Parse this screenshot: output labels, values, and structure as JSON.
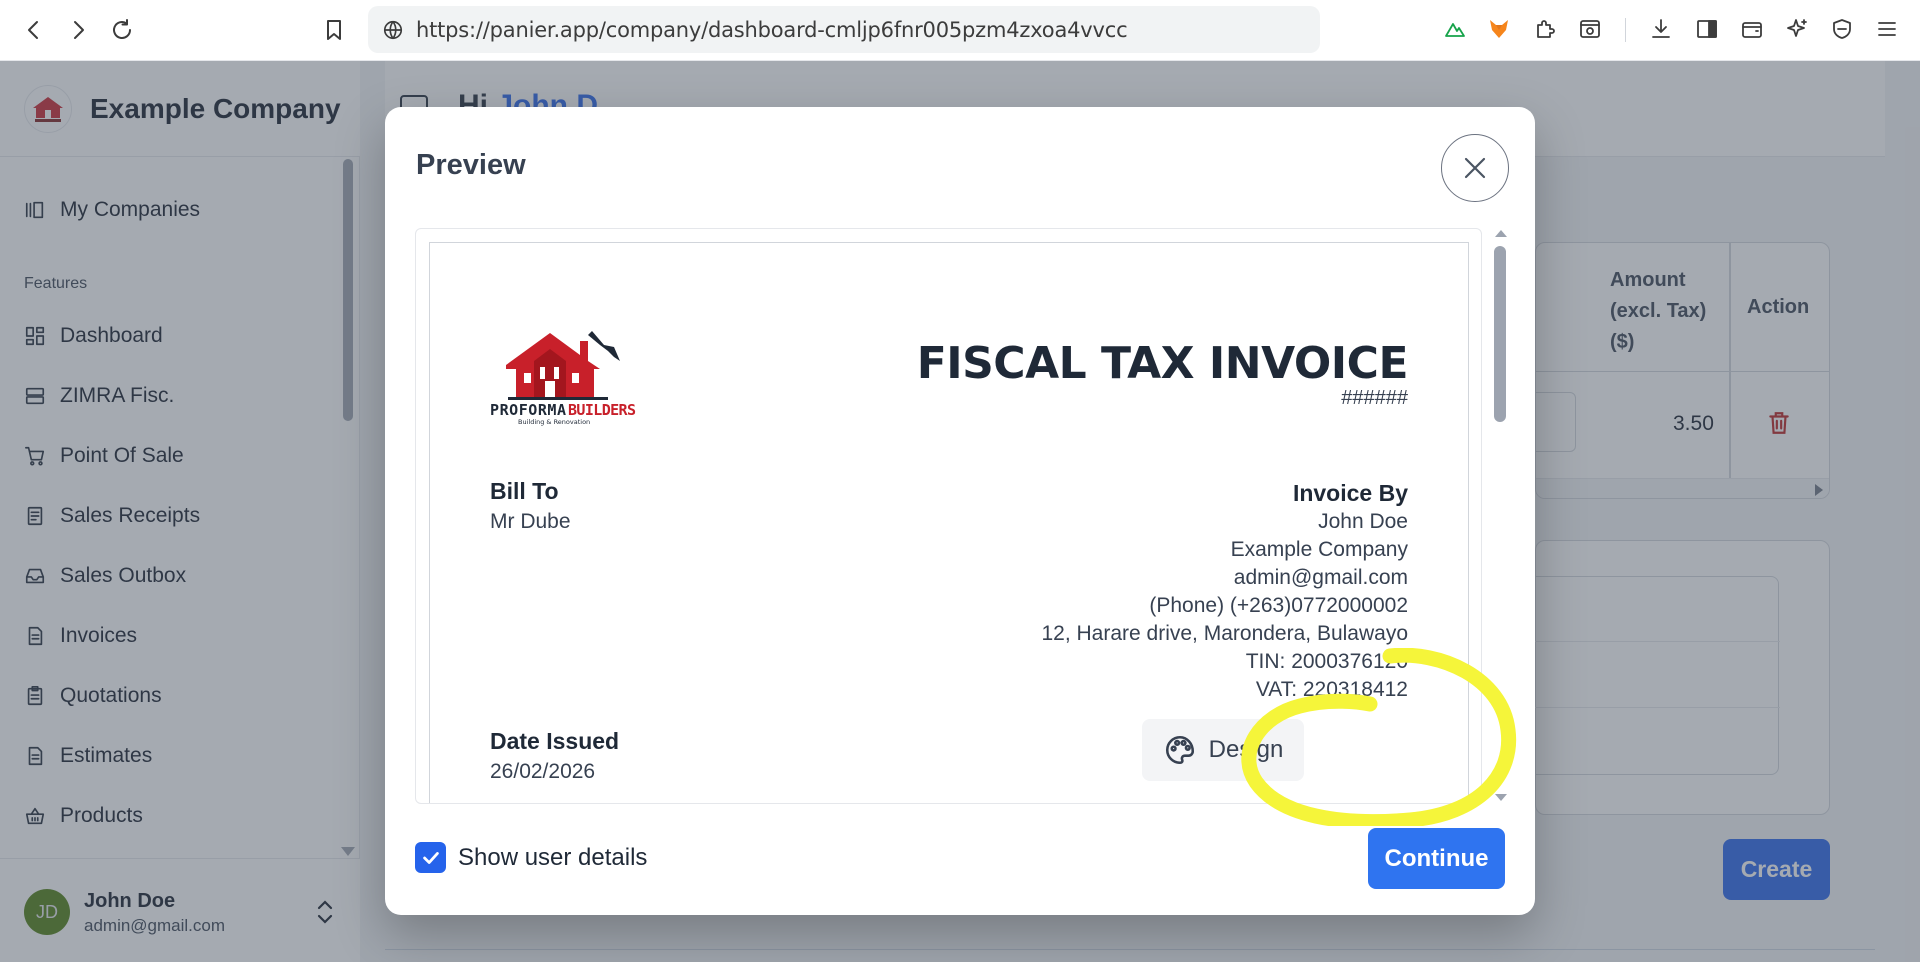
{
  "browser": {
    "url": "https://panier.app/company/dashboard-cmljp6fnr005pzm4zxoa4vvcc"
  },
  "app": {
    "company_name": "Example Company",
    "main_title_dark": "Hi",
    "main_title_blue": "John D",
    "sidebar": {
      "top_item": "My Companies",
      "section_label": "Features",
      "items": [
        {
          "label": "Dashboard",
          "icon": "dashboard-icon"
        },
        {
          "label": "ZIMRA Fisc.",
          "icon": "server-icon"
        },
        {
          "label": "Point Of Sale",
          "icon": "cart-icon"
        },
        {
          "label": "Sales Receipts",
          "icon": "receipt-icon"
        },
        {
          "label": "Sales Outbox",
          "icon": "inbox-icon"
        },
        {
          "label": "Invoices",
          "icon": "document-icon"
        },
        {
          "label": "Quotations",
          "icon": "clipboard-icon"
        },
        {
          "label": "Estimates",
          "icon": "document-icon"
        },
        {
          "label": "Products",
          "icon": "basket-icon"
        }
      ]
    },
    "user": {
      "initials": "JD",
      "name": "John Doe",
      "email": "admin@gmail.com"
    },
    "table": {
      "amount_header_l1": "Amount",
      "amount_header_l2": "(excl. Tax)",
      "amount_header_l3": "($)",
      "action_header": "Action",
      "row_amount": "3.50"
    },
    "create_label": "Create"
  },
  "modal": {
    "title": "Preview",
    "invoice": {
      "title": "FISCAL TAX INVOICE",
      "number": "######",
      "logo_text": "PROFORMA BUILDERS",
      "logo_subtext": "Building & Renovation",
      "bill_to_label": "Bill To",
      "bill_to_name": "Mr Dube",
      "invoice_by_label": "Invoice By",
      "invoice_by_lines": [
        "John Doe",
        "Example Company",
        "admin@gmail.com",
        "(Phone) (+263)0772000002",
        "12, Harare drive, Marondera, Bulawayo",
        "TIN: 2000376120",
        "VAT: 220318412"
      ],
      "date_issued_label": "Date Issued",
      "date_issued": "26/02/2026"
    },
    "design_label": "Design",
    "show_user_details_label": "Show user details",
    "show_user_details_checked": true,
    "continue_label": "Continue"
  },
  "colors": {
    "accent": "#2563eb",
    "highlight": "#f5f53a",
    "logo_red": "#c8202a"
  }
}
